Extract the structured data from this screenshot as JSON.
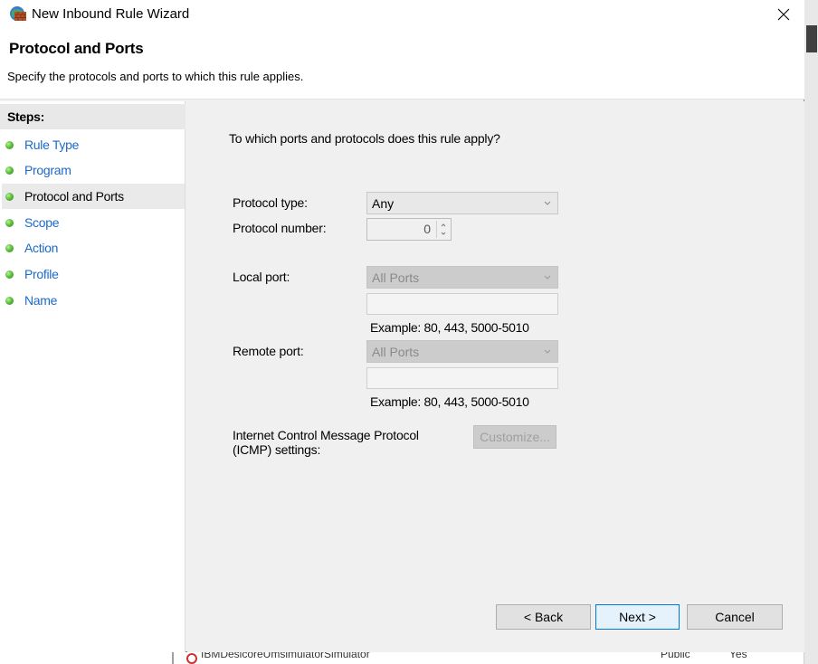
{
  "window": {
    "title": "New Inbound Rule Wizard"
  },
  "header": {
    "title": "Protocol and Ports",
    "subtitle": "Specify the protocols and ports to which this rule applies."
  },
  "steps": {
    "title": "Steps:",
    "items": [
      {
        "label": "Rule Type",
        "active": false
      },
      {
        "label": "Program",
        "active": false
      },
      {
        "label": "Protocol and Ports",
        "active": true
      },
      {
        "label": "Scope",
        "active": false
      },
      {
        "label": "Action",
        "active": false
      },
      {
        "label": "Profile",
        "active": false
      },
      {
        "label": "Name",
        "active": false
      }
    ]
  },
  "content": {
    "question": "To which ports and protocols does this rule apply?",
    "protocol_type_label": "Protocol type:",
    "protocol_type_value": "Any",
    "protocol_number_label": "Protocol number:",
    "protocol_number_value": "0",
    "local_port_label": "Local port:",
    "local_port_value": "All Ports",
    "local_port_text": "",
    "local_example": "Example: 80, 443, 5000-5010",
    "remote_port_label": "Remote port:",
    "remote_port_value": "All Ports",
    "remote_port_text": "",
    "remote_example": "Example: 80, 443, 5000-5010",
    "icmp_label_line1": "Internet Control Message Protocol",
    "icmp_label_line2": "(ICMP) settings:",
    "customize_label": "Customize..."
  },
  "buttons": {
    "back": "< Back",
    "next": "Next >",
    "cancel": "Cancel"
  },
  "background": {
    "row_text": "IBMDesicoreUmsimulatorSimulator",
    "row_col2": "Public",
    "row_col3": "Yes"
  },
  "colors": {
    "link": "#1b6ac9",
    "accent": "#0078d7",
    "step_dot": "#5fbf3a"
  }
}
